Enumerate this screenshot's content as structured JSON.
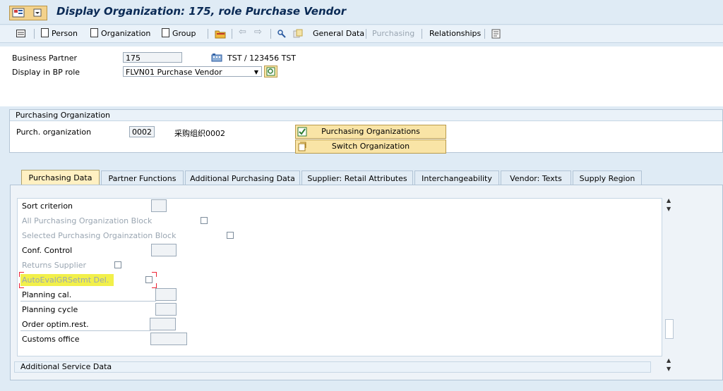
{
  "window": {
    "title": "Display Organization: 175, role Purchase Vendor"
  },
  "toolbar": {
    "person": "Person",
    "organization": "Organization",
    "group": "Group",
    "general_data": "General Data",
    "purchasing": "Purchasing",
    "relationships": "Relationships"
  },
  "header": {
    "bp_label": "Business Partner",
    "bp_value": "175",
    "bp_desc": "TST / 123456 TST",
    "role_label": "Display in BP role",
    "role_value": "FLVN01 Purchase Vendor"
  },
  "org": {
    "group_title": "Purchasing Organization",
    "label": "Purch. organization",
    "value": "0002",
    "desc": "采购组织0002",
    "btn_orgs": "Purchasing Organizations",
    "btn_switch": "Switch Organization"
  },
  "tabs": [
    "Purchasing Data",
    "Partner Functions",
    "Additional Purchasing Data",
    "Supplier: Retail Attributes",
    "Interchangeability",
    "Vendor: Texts",
    "Supply Region"
  ],
  "fields": {
    "sort": "Sort criterion",
    "all_block": "All Purchasing Organization Block",
    "sel_block": "Selected Purchasing Orgainzation Block",
    "conf": "Conf. Control",
    "returns": "Returns Supplier",
    "autoeval": "AutoEvalGRSetmt Del.",
    "planning_cal": "Planning cal.",
    "planning_cycle": "Planning cycle",
    "order_optim": "Order optim.rest.",
    "customs": "Customs office"
  },
  "additional": {
    "title": "Additional Service Data"
  },
  "colors": {
    "background": "#dfebf5",
    "highlight": "#f2f04a",
    "button": "#f9e4a6"
  }
}
